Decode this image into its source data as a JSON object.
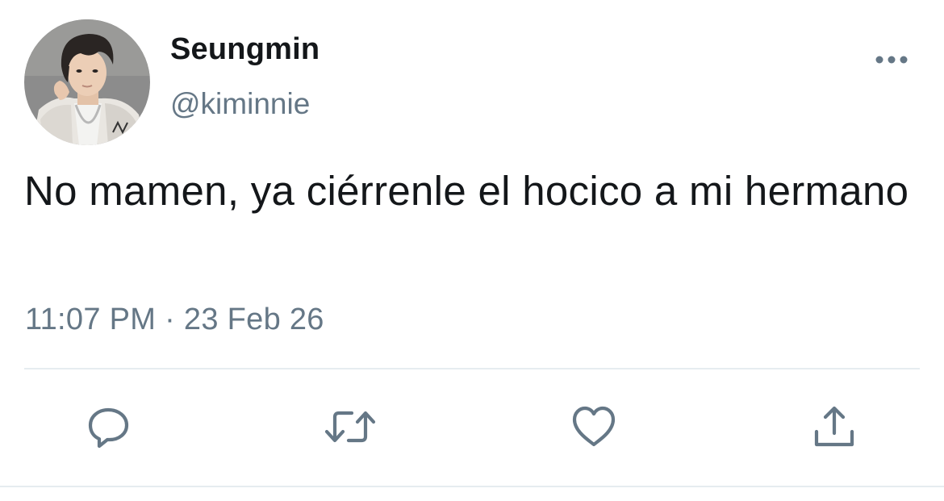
{
  "tweet": {
    "author": {
      "display_name": "Seungmin",
      "handle": "@kiminnie",
      "avatar_icon": "profile-photo"
    },
    "text": "No mamen, ya ciérrenle el hocico a mi hermano",
    "timestamp": "11:07 PM · 23 Feb 26",
    "menu_icon": "more-dots-icon"
  },
  "actions": [
    {
      "name": "reply",
      "icon": "speech-bubble-icon"
    },
    {
      "name": "retweet",
      "icon": "retweet-arrows-icon"
    },
    {
      "name": "like",
      "icon": "heart-icon"
    },
    {
      "name": "share",
      "icon": "upload-icon"
    }
  ],
  "colors": {
    "text_primary": "#14171a",
    "text_secondary": "#657786",
    "icon": "#657786",
    "divider": "#e6ecf0"
  }
}
